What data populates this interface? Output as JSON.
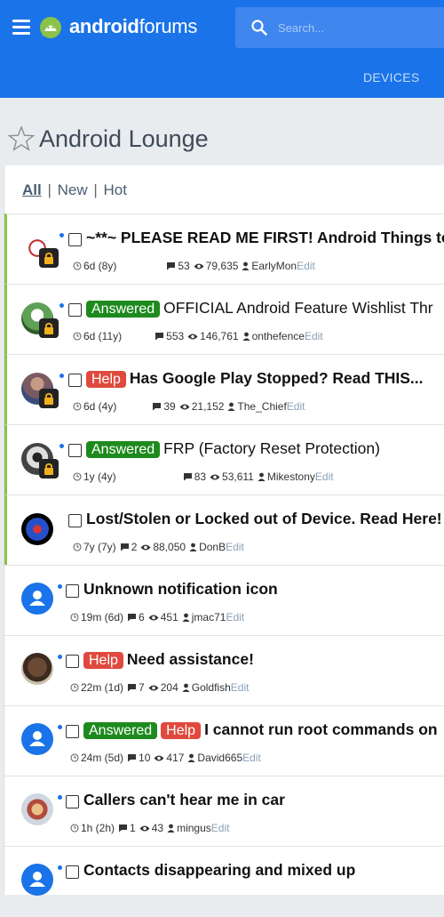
{
  "header": {
    "logo_bold": "android",
    "logo_light": "forums",
    "search_placeholder": "Search...",
    "nav_devices": "DEVICES"
  },
  "forum": {
    "title": "Android Lounge"
  },
  "filters": {
    "all": "All",
    "new": "New",
    "hot": "Hot",
    "sep": "|"
  },
  "colors": {
    "brand": "#1a73e8",
    "answered": "#1e8a1e",
    "help": "#e0493d",
    "sticky": "#8bc34a"
  },
  "threads": [
    {
      "title": "~**~ PLEASE READ ME FIRST! Android Things to K",
      "badges": [],
      "time": "6d (8y)",
      "replies": "53",
      "views": "79,635",
      "author": "EarlyMon",
      "edit": "Edit",
      "sticky": true
    },
    {
      "title": "OFFICIAL Android Feature Wishlist Thr",
      "badges": [
        "Answered"
      ],
      "time": "6d (11y)",
      "replies": "553",
      "views": "146,761",
      "author": "onthefence",
      "edit": "Edit",
      "sticky": true
    },
    {
      "title": "Has Google Play Stopped? Read THIS...",
      "badges": [
        "Help"
      ],
      "time": "6d (4y)",
      "replies": "39",
      "views": "21,152",
      "author": "The_Chief",
      "edit": "Edit",
      "sticky": true
    },
    {
      "title": "FRP (Factory Reset Protection)",
      "badges": [
        "Answered"
      ],
      "time": "1y (4y)",
      "replies": "83",
      "views": "53,611",
      "author": "Mikestony",
      "edit": "Edit",
      "sticky": true
    },
    {
      "title": "Lost/Stolen or Locked out of Device. Read Here!",
      "badges": [],
      "time": "7y (7y)",
      "replies": "2",
      "views": "88,050",
      "author": "DonB",
      "edit": "Edit",
      "sticky": true
    },
    {
      "title": "Unknown notification icon",
      "badges": [],
      "time": "19m (6d)",
      "replies": "6",
      "views": "451",
      "author": "jmac71",
      "edit": "Edit",
      "sticky": false
    },
    {
      "title": "Need assistance!",
      "badges": [
        "Help"
      ],
      "time": "22m (1d)",
      "replies": "7",
      "views": "204",
      "author": "Goldfish",
      "edit": "Edit",
      "sticky": false
    },
    {
      "title": "I cannot run root commands on",
      "badges": [
        "Answered",
        "Help"
      ],
      "time": "24m (5d)",
      "replies": "10",
      "views": "417",
      "author": "David665",
      "edit": "Edit",
      "sticky": false
    },
    {
      "title": "Callers can't hear me in car",
      "badges": [],
      "time": "1h (2h)",
      "replies": "1",
      "views": "43",
      "author": "mingus",
      "edit": "Edit",
      "sticky": false
    },
    {
      "title": "Contacts disappearing and mixed up",
      "badges": [],
      "time": "",
      "replies": "",
      "views": "",
      "author": "",
      "edit": "",
      "sticky": false
    }
  ]
}
